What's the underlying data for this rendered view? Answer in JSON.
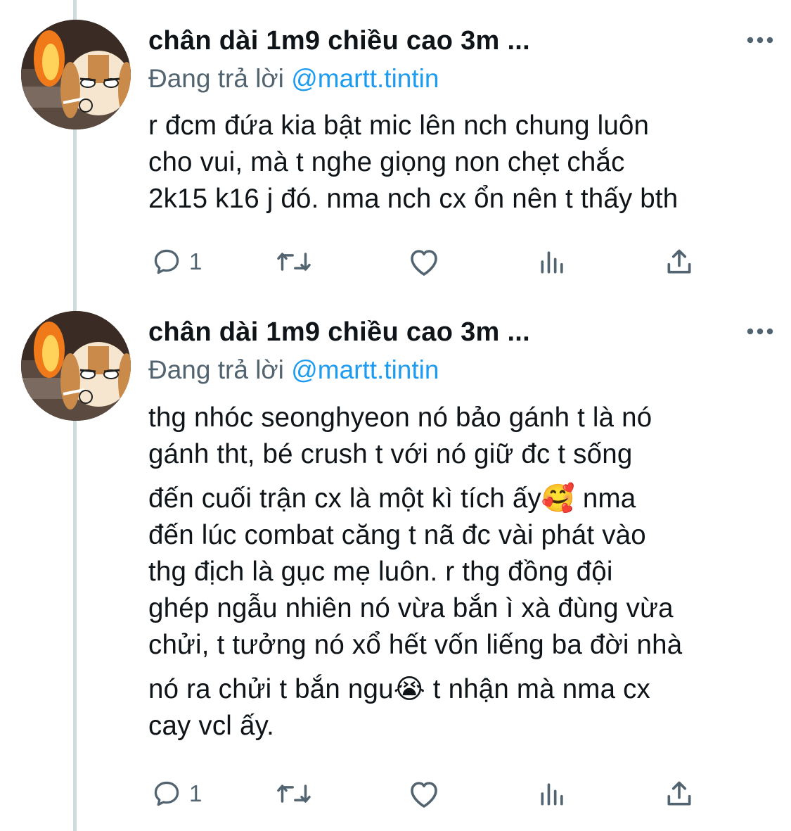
{
  "tweets": [
    {
      "display_name": "chân dài 1m9 chiều cao 3m ...",
      "reply_prefix": "Đang trả lời ",
      "reply_handle": "@martt.tintin",
      "lines": [
        "r đcm đứa kia bật mic lên nch chung luôn",
        "cho vui, mà t nghe giọng non chẹt chắc",
        "2k15 k16 j đó. nma nch cx ổn nên t thấy bth"
      ],
      "reply_count": "1"
    },
    {
      "display_name": "chân dài 1m9 chiều cao 3m ...",
      "reply_prefix": "Đang trả lời ",
      "reply_handle": "@martt.tintin",
      "lines": [
        "thg nhóc seonghyeon nó bảo gánh t là nó",
        "gánh tht, bé crush t với nó giữ đc t sống",
        "đến cuối trận cx là một kì tích ấy🥰  nma",
        "đến lúc combat căng t nã đc vài phát vào",
        "thg địch là gục mẹ luôn. r thg đồng đội",
        "ghép ngẫu nhiên nó vừa bắn ì xà đùng vừa",
        "chửi, t tưởng nó xổ hết vốn liếng ba đời nhà",
        "nó ra chửi t bắn ngu😭  t nhận mà nma cx",
        "cay vcl ấy."
      ],
      "reply_count": "1"
    }
  ],
  "icons": {
    "more": "more-horizontal-icon",
    "reply": "reply-bubble-icon",
    "retweet": "retweet-icon",
    "like": "heart-icon",
    "views": "views-chart-icon",
    "share": "share-icon"
  },
  "colors": {
    "text": "#0f1419",
    "secondary": "#536471",
    "link": "#1d9bf0",
    "thread_line": "#cfd9de"
  }
}
